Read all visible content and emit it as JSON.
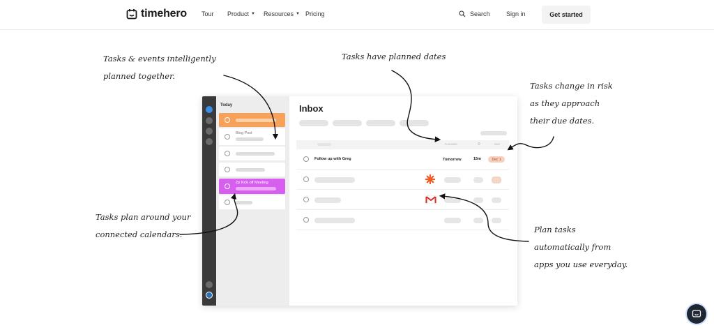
{
  "nav": {
    "logo_text": "timehero",
    "links": [
      {
        "label": "Tour"
      },
      {
        "label": "Product",
        "caret": "▼"
      },
      {
        "label": "Resources",
        "caret": "▼"
      },
      {
        "label": "Pricing"
      }
    ],
    "search_label": "Search",
    "signin_label": "Sign in",
    "cta_label": "Get started"
  },
  "notes": {
    "events": "Tasks & events intelligently\nplanned together.",
    "planned": "Tasks have planned dates",
    "risk": "Tasks change in risk\nas they approach\ntheir due dates.",
    "calendars": "Tasks plan around your\nconnected calendars.",
    "apps": "Plan tasks\nautomatically from\napps you use everyday."
  },
  "app": {
    "sidebar_title": "Today",
    "tasks": {
      "blog_post": "Blog Post",
      "kickoff": "2p  Kick off Meeting"
    },
    "inbox_title": "Inbox",
    "columns": {
      "planned": "PLANNED",
      "due": "DUE"
    },
    "row1": {
      "task": "Follow up with Greg",
      "planned": "Tomorrow",
      "duration": "15m",
      "due": "Dec 1"
    },
    "colors": {
      "orange": "#f7a25a",
      "magenta": "#d65ff0",
      "rail": "#3a3a3a",
      "rail_active": "#3a8ee6"
    }
  }
}
